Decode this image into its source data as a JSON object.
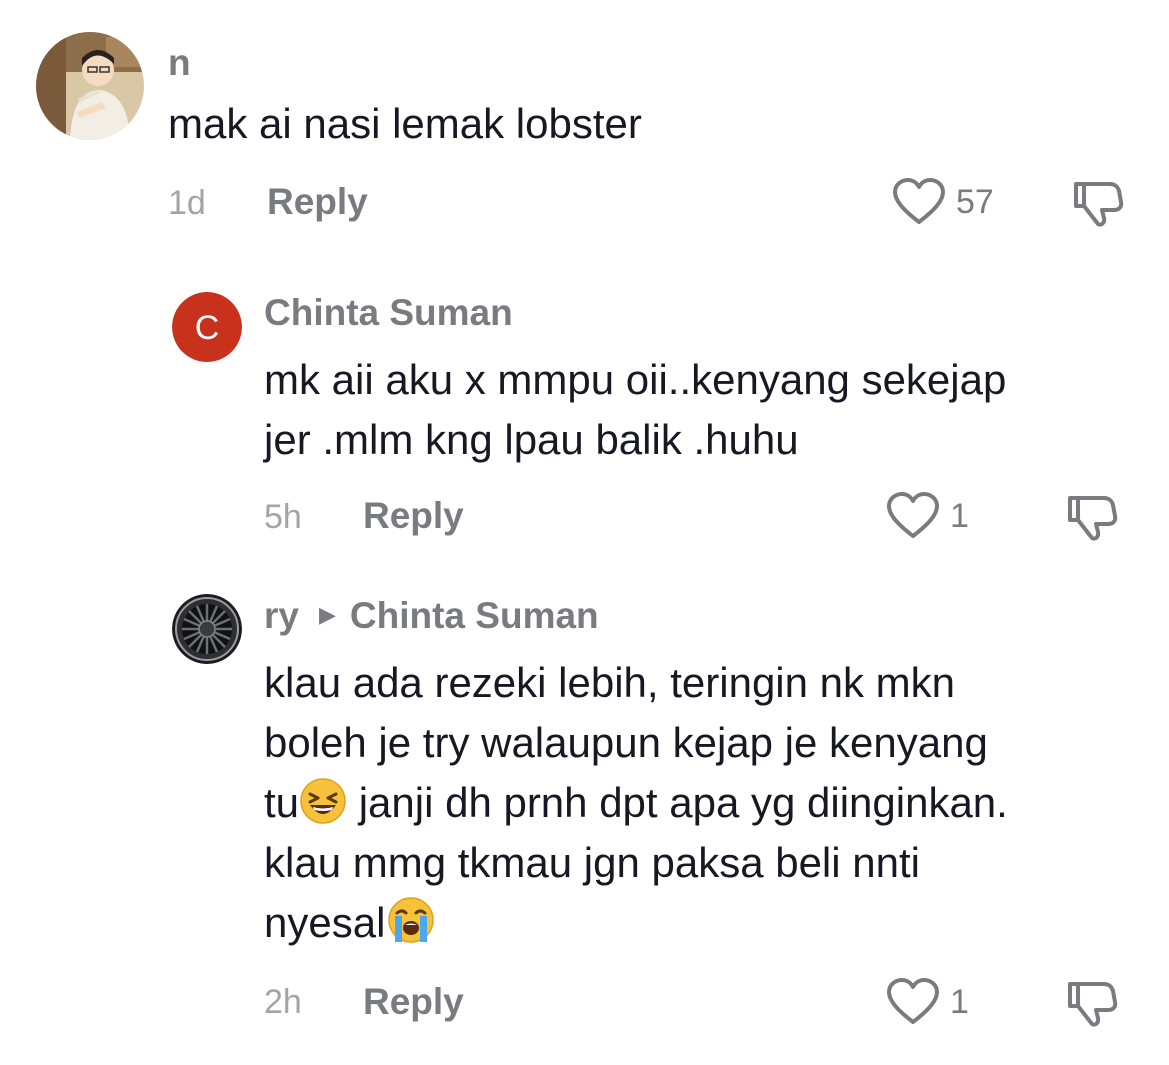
{
  "comments": [
    {
      "author": "n",
      "lines": [
        "mak ai nasi lemak lobster"
      ],
      "time": "1d",
      "reply_label": "Reply",
      "likes": "57",
      "avatar": "illustrated-man-portrait"
    },
    {
      "author": "Chinta Suman",
      "avatar_letter": "C",
      "avatar_color": "#c8311b",
      "lines": [
        "mk aii aku x mmpu oii..kenyang sekejap",
        "jer .mlm kng lpau balik .huhu"
      ],
      "time": "5h",
      "reply_label": "Reply",
      "likes": "1"
    },
    {
      "author": "ry",
      "reply_to": "Chinta Suman",
      "avatar": "car-wheel-rim",
      "lines": [
        "klau ada rezeki lebih, teringin nk mkn",
        "boleh je try walaupun kejap je kenyang",
        "tu",
        " janji dh prnh dpt apa yg diinginkan.",
        "klau mmg tkmau jgn paksa beli nnti",
        "nyesal"
      ],
      "emojis": [
        "grinning-squinting-face",
        "loudly-crying-face"
      ],
      "time": "2h",
      "reply_label": "Reply",
      "likes": "1"
    }
  ],
  "icons": {
    "like": "heart-outline-icon",
    "dislike": "thumbs-down-outline-icon"
  }
}
